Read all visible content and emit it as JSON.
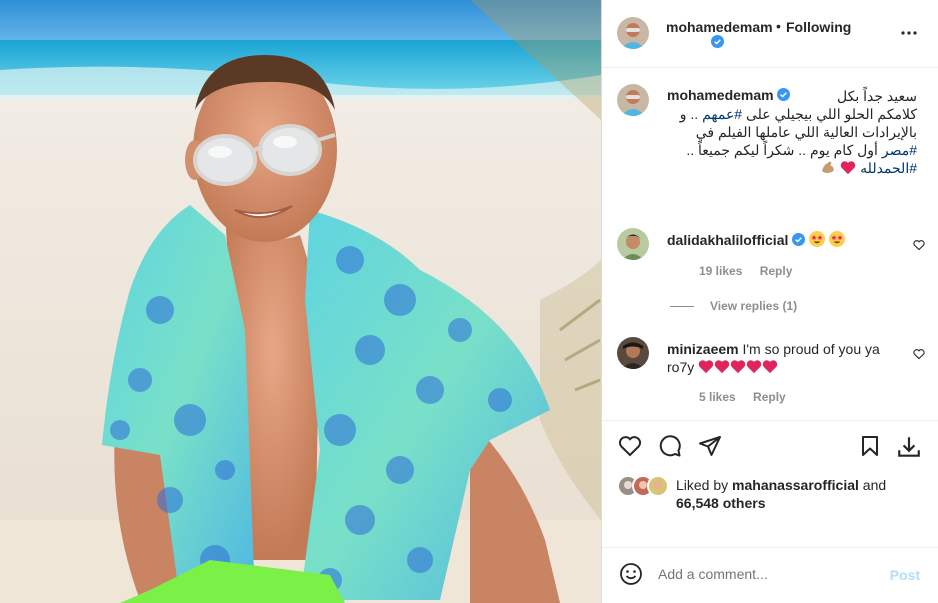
{
  "post": {
    "author": "mohamedemam",
    "follow_state": "Following",
    "dot": "•"
  },
  "caption": {
    "user": "mohamedemam",
    "lines": [
      "سعيد جداً بكل",
      "كلامكم الحلو اللي بيجيلي على",
      "بالإيرادات العالية اللي عاملها الفيلم في",
      "أول كام يوم .. شكراً ليكم جميعاً ..",
      ""
    ],
    "tag1": "#عمهم",
    "tag1_after": ".. و",
    "tag2": "#مصر",
    "tag3": "#الحمدلله"
  },
  "comments": [
    {
      "user": "dalidakhalilofficial",
      "text": "",
      "likes": "19 likes",
      "reply": "Reply"
    },
    {
      "user": "minizaeem",
      "text": "I'm so proud of you ya ro7y",
      "likes": "5 likes",
      "reply": "Reply"
    }
  ],
  "view_replies": "View replies (1)",
  "likes": {
    "prefix": "Liked by",
    "user": "mahanassarofficial",
    "mid": "and",
    "count": "66,548 others"
  },
  "add_comment": {
    "placeholder": "Add a comment...",
    "post_label": "Post"
  },
  "colors": {
    "verified": "#3897f0",
    "tag": "#00376b",
    "heart": "#ed4956",
    "post_disabled": "#b2dffc"
  },
  "icons": [
    "more-icon",
    "verified-icon",
    "heart-icon",
    "comment-icon",
    "share-icon",
    "bookmark-icon",
    "download-icon",
    "emoji-icon"
  ]
}
